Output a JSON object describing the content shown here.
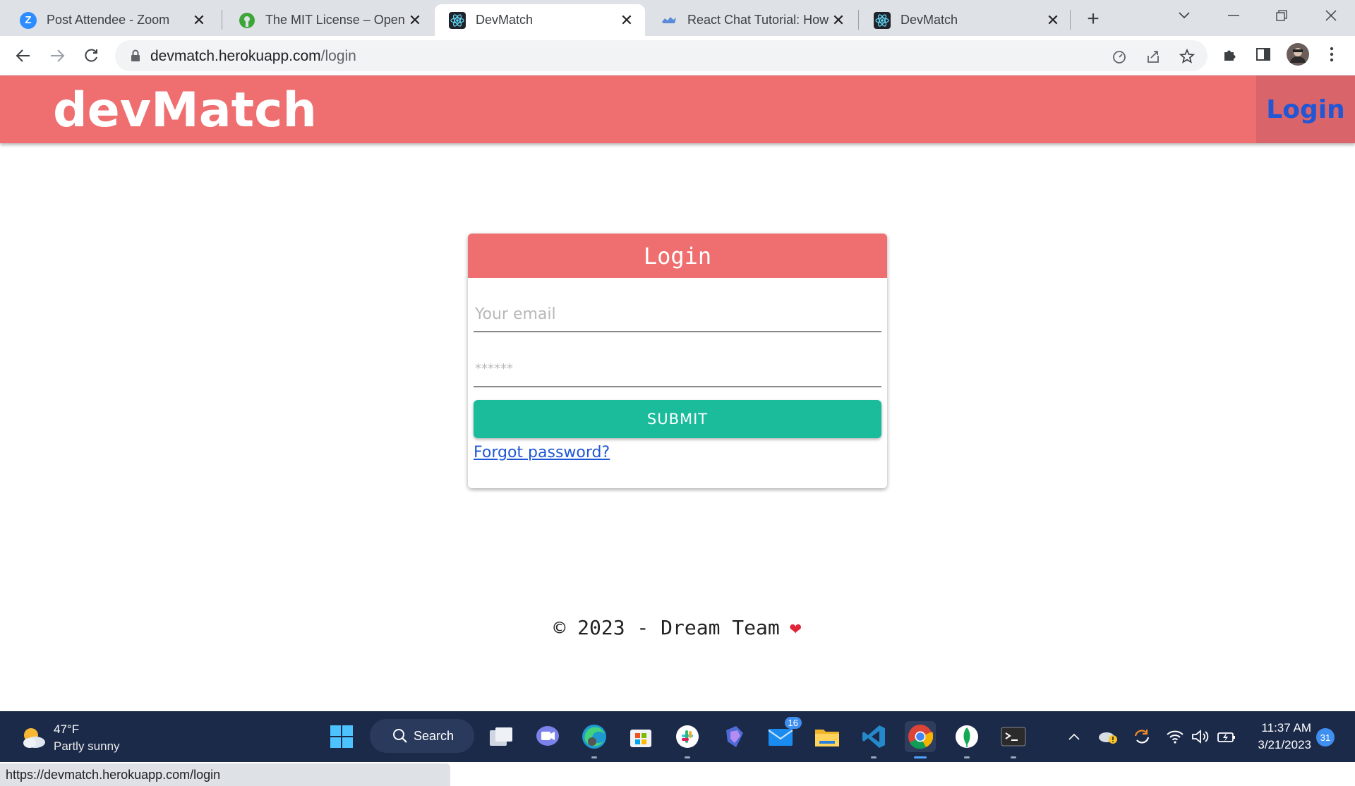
{
  "browser": {
    "tabs": [
      {
        "title": "Post Attendee - Zoom",
        "icon": "zoom-icon"
      },
      {
        "title": "The MIT License – Open S",
        "icon": "open-source-icon"
      },
      {
        "title": "DevMatch",
        "icon": "react-icon",
        "active": true
      },
      {
        "title": "React Chat Tutorial: How t",
        "icon": "chat-icon"
      },
      {
        "title": "DevMatch",
        "icon": "react-icon"
      }
    ],
    "address": {
      "host": "devmatch.herokuapp.com",
      "path": "/login"
    },
    "status_url": "https://devmatch.herokuapp.com/login"
  },
  "app": {
    "brand": "devMatch",
    "nav_login": "Login",
    "colors": {
      "header": "#ef6e6f",
      "accent": "#1abc9c",
      "link": "#1f57d6"
    }
  },
  "login": {
    "title": "Login",
    "email_placeholder": "Your email",
    "password_placeholder": "******",
    "submit_label": "SUBMIT",
    "forgot_label": "Forgot password?"
  },
  "footer": {
    "text": "© 2023 - Dream Team",
    "heart": "❤"
  },
  "taskbar": {
    "weather_temp": "47°F",
    "weather_desc": "Partly sunny",
    "search_label": "Search",
    "mail_badge": "16",
    "time": "11:37 AM",
    "date": "3/21/2023",
    "notifications": "31"
  }
}
